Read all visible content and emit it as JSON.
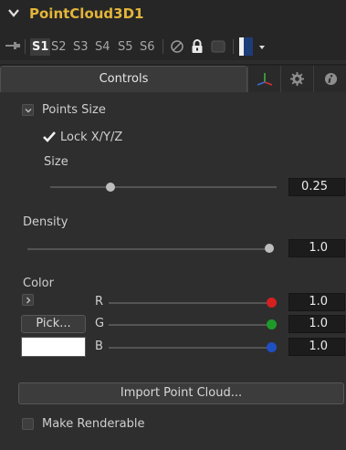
{
  "header": {
    "title": "PointCloud3D1"
  },
  "toolbar": {
    "slots": [
      "S1",
      "S2",
      "S3",
      "S4",
      "S5",
      "S6"
    ],
    "active_slot": "S1"
  },
  "tabs": {
    "controls": "Controls"
  },
  "points_size": {
    "section_label": "Points Size",
    "lock_label": "Lock X/Y/Z",
    "lock_checked": true,
    "size_label": "Size",
    "size_value": "0.25",
    "size_slider_fraction": 0.25
  },
  "density": {
    "label": "Density",
    "value": "1.0",
    "slider_fraction": 1.0
  },
  "color": {
    "label": "Color",
    "pick_label": "Pick...",
    "swatch_color": "#ffffff",
    "channels": [
      {
        "name": "R",
        "value": "1.0",
        "knob_color": "#d42020"
      },
      {
        "name": "G",
        "value": "1.0",
        "knob_color": "#1e9a2a"
      },
      {
        "name": "B",
        "value": "1.0",
        "knob_color": "#1f4fc0"
      }
    ]
  },
  "import_button": "Import Point Cloud...",
  "make_renderable": {
    "label": "Make Renderable",
    "checked": false
  },
  "colors": {
    "accent": "#e3b53a"
  },
  "icons": [
    "chevron-down-icon",
    "pin-icon",
    "circle-slash-icon",
    "lock-icon",
    "swatch-icon",
    "axis-icon",
    "gear-icon",
    "info-icon",
    "checkmark-icon",
    "chevron-right-icon"
  ]
}
